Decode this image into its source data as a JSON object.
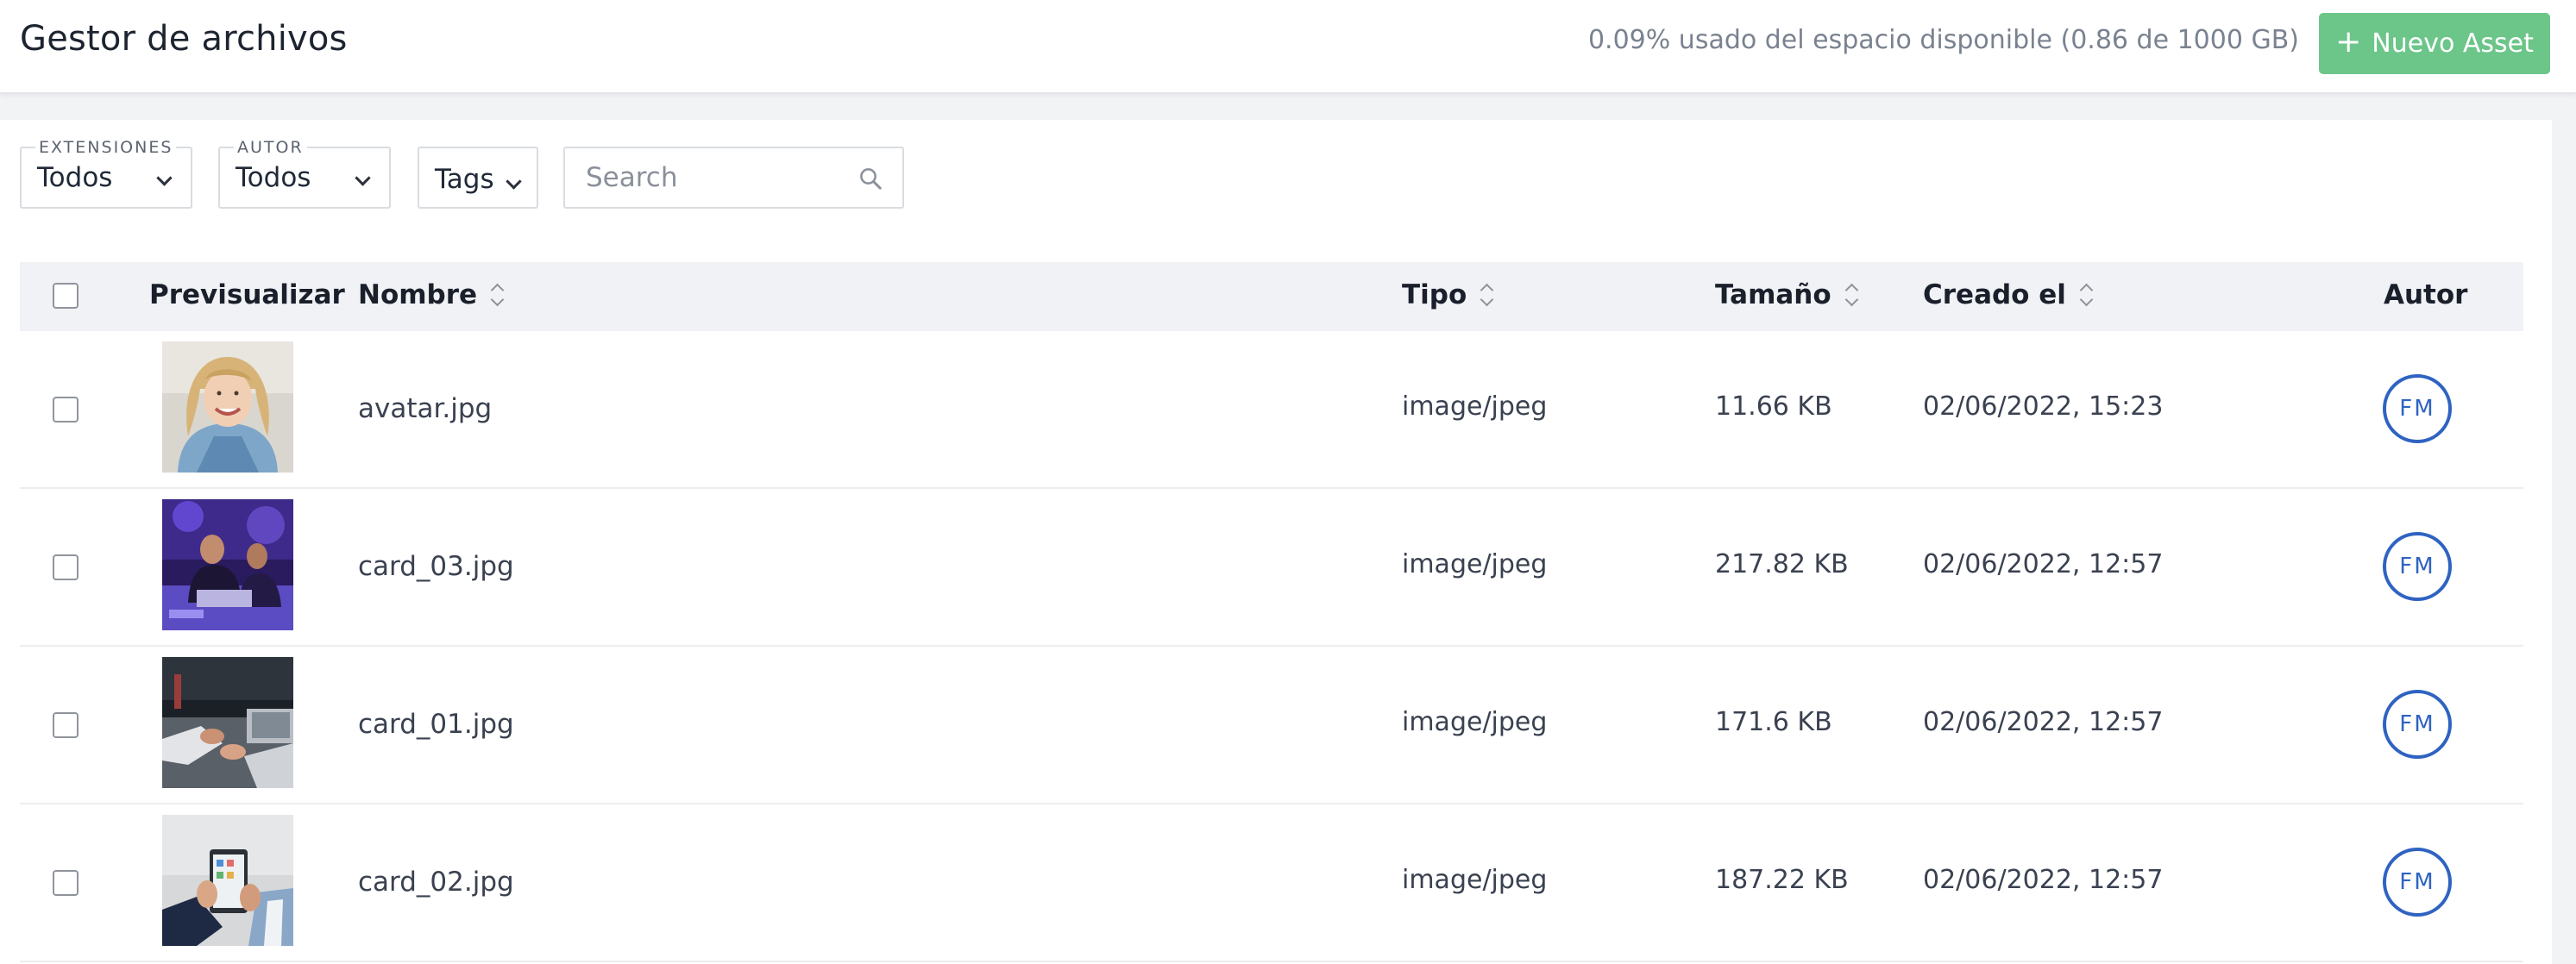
{
  "header": {
    "title": "Gestor de archivos",
    "usage_text": "0.09% usado del espacio disponible (0.86 de 1000 GB)",
    "new_button": {
      "icon": "+",
      "label": "Nuevo Asset"
    },
    "accent_color": "#6cc589"
  },
  "filters": {
    "extensions": {
      "label": "EXTENSIONES",
      "value": "Todos"
    },
    "author": {
      "label": "AUTOR",
      "value": "Todos"
    },
    "tags": {
      "value": "Tags"
    },
    "search": {
      "placeholder": "Search",
      "value": ""
    }
  },
  "table": {
    "columns": {
      "preview": "Previsualizar",
      "name": "Nombre",
      "type": "Tipo",
      "size": "Tamaño",
      "created": "Creado el",
      "author": "Autor"
    },
    "rows": [
      {
        "name": "avatar.jpg",
        "type": "image/jpeg",
        "size": "11.66 KB",
        "created": "02/06/2022, 15:23",
        "author": "FM",
        "thumbnail": "smiling-woman-portrait"
      },
      {
        "name": "card_03.jpg",
        "type": "image/jpeg",
        "size": "217.82 KB",
        "created": "02/06/2022, 12:57",
        "author": "FM",
        "thumbnail": "people-with-laptop-purple-light"
      },
      {
        "name": "card_01.jpg",
        "type": "image/jpeg",
        "size": "171.6 KB",
        "created": "02/06/2022, 12:57",
        "author": "FM",
        "thumbnail": "hands-at-desk-with-laptop"
      },
      {
        "name": "card_02.jpg",
        "type": "image/jpeg",
        "size": "187.22 KB",
        "created": "02/06/2022, 12:57",
        "author": "FM",
        "thumbnail": "hands-holding-phone"
      }
    ]
  },
  "colors": {
    "author_badge": "#2f63c2",
    "header_row_bg": "#f1f2f5"
  }
}
